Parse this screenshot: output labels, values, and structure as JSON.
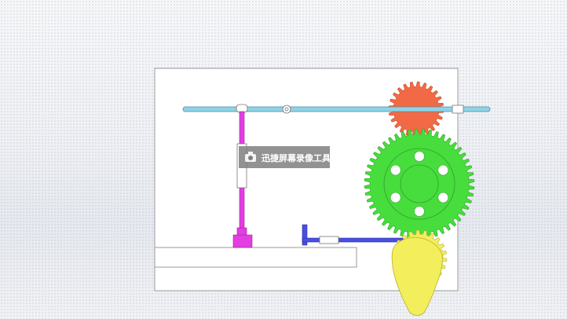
{
  "diagram": {
    "kind": "gear and cam mechanism animation frame",
    "components": [
      {
        "name": "frame-plate",
        "color": "#ffffff"
      },
      {
        "name": "base-block",
        "color": "#ffffff"
      },
      {
        "name": "horizontal-rack-bar",
        "color": "#8fd3e6"
      },
      {
        "name": "red-gear",
        "color": "#f26a45"
      },
      {
        "name": "green-gear",
        "color": "#47dd3d",
        "holes": 6
      },
      {
        "name": "magenta-vertical-rod",
        "color": "#e23ee2"
      },
      {
        "name": "blue-lever",
        "color": "#4a4fe0"
      },
      {
        "name": "yellow-cam",
        "color": "#f3ee5c"
      }
    ]
  },
  "watermark": {
    "text": "迅捷屏幕录像工具",
    "icon": "camera-icon"
  }
}
